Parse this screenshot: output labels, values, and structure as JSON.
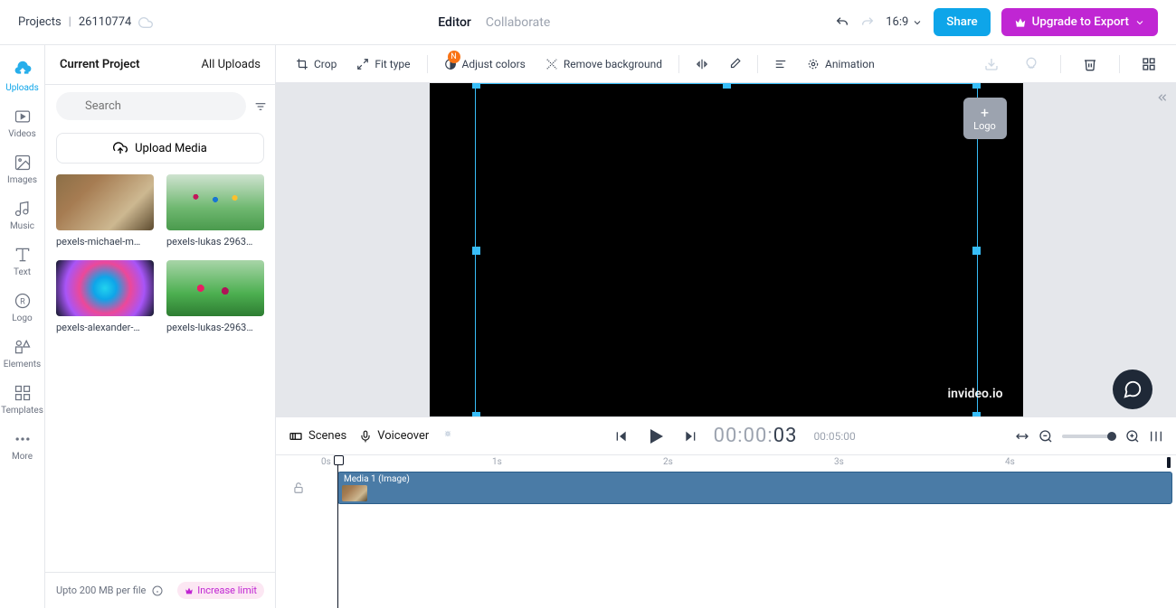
{
  "header": {
    "projects_label": "Projects",
    "project_id": "26110774",
    "tabs": {
      "editor": "Editor",
      "collaborate": "Collaborate"
    },
    "aspect": "16:9",
    "share": "Share",
    "upgrade": "Upgrade to Export"
  },
  "sidenav": [
    {
      "key": "uploads",
      "label": "Uploads"
    },
    {
      "key": "videos",
      "label": "Videos"
    },
    {
      "key": "images",
      "label": "Images"
    },
    {
      "key": "music",
      "label": "Music"
    },
    {
      "key": "text",
      "label": "Text"
    },
    {
      "key": "logo",
      "label": "Logo"
    },
    {
      "key": "elements",
      "label": "Elements"
    },
    {
      "key": "templates",
      "label": "Templates"
    },
    {
      "key": "more",
      "label": "More"
    }
  ],
  "panel": {
    "tab_current": "Current Project",
    "tab_all": "All Uploads",
    "search_placeholder": "Search",
    "upload_label": "Upload Media",
    "media": [
      {
        "name": "pexels-michael-m…"
      },
      {
        "name": "pexels-lukas 2963…"
      },
      {
        "name": "pexels-alexander-…"
      },
      {
        "name": "pexels-lukas-2963…"
      }
    ],
    "foot_limit": "Upto 200 MB per file",
    "increase": "Increase limit"
  },
  "toolbar": {
    "crop": "Crop",
    "fit": "Fit type",
    "adjust": "Adjust colors",
    "remove_bg": "Remove background",
    "animation": "Animation",
    "badge_n": "N"
  },
  "canvas": {
    "logo_label": "Logo",
    "watermark": "invideo.io"
  },
  "timeline_head": {
    "scenes": "Scenes",
    "voiceover": "Voiceover",
    "time_prefix": "00:00:",
    "time_sec": "03",
    "duration": "00:05:00"
  },
  "timeline": {
    "ticks": [
      "0s",
      "1s",
      "2s",
      "3s",
      "4s"
    ],
    "clip_label": "Media 1 (Image)"
  }
}
